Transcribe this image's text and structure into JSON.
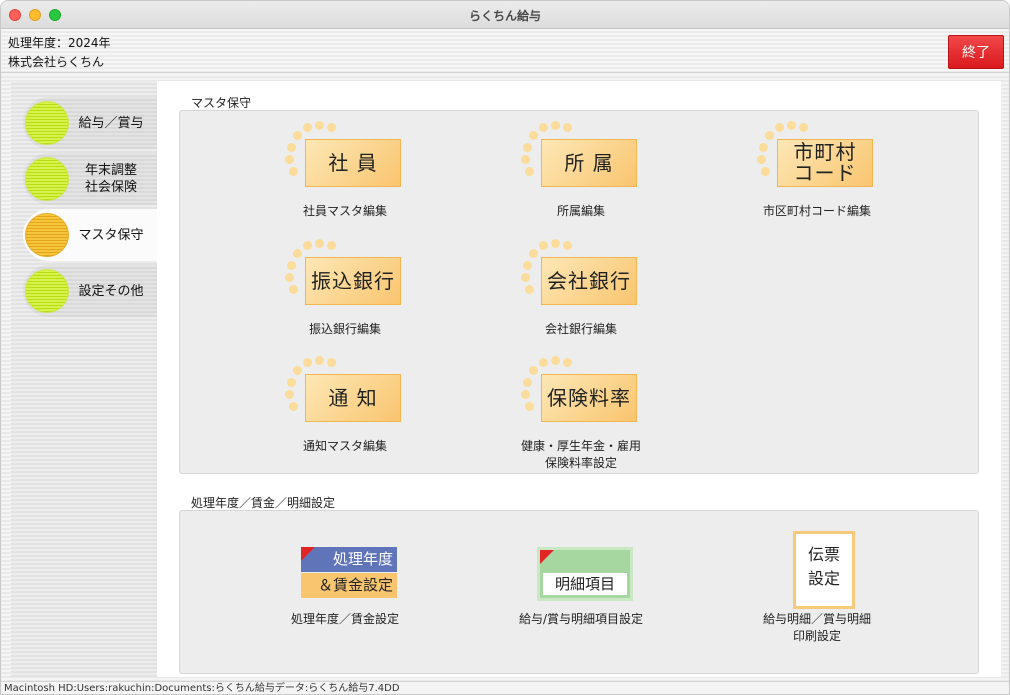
{
  "window": {
    "title": "らくちん給与"
  },
  "header": {
    "year_line": "処理年度：2024年",
    "company": "株式会社らくちん",
    "exit_label": "終了"
  },
  "sidebar": {
    "items": [
      {
        "lines": [
          "給与／賞与"
        ],
        "active": false
      },
      {
        "lines": [
          "年末調整",
          "社会保険"
        ],
        "active": false
      },
      {
        "lines": [
          "マスタ保守"
        ],
        "active": true
      },
      {
        "lines": [
          "設定その他"
        ],
        "active": false
      }
    ]
  },
  "sections": {
    "master": {
      "title": "マスタ保守",
      "tiles": [
        {
          "button": "社 員",
          "caption": [
            "社員マスタ編集"
          ]
        },
        {
          "button": "所 属",
          "caption": [
            "所属編集"
          ]
        },
        {
          "button_lines": [
            "市町村",
            "コード"
          ],
          "caption": [
            "市区町村コード編集"
          ]
        },
        {
          "button": "振込銀行",
          "caption": [
            "振込銀行編集"
          ]
        },
        {
          "button": "会社銀行",
          "caption": [
            "会社銀行編集"
          ]
        },
        {
          "button": "通 知",
          "caption": [
            "通知マスタ編集"
          ]
        },
        {
          "button": "保険料率",
          "caption": [
            "健康・厚生年金・雇用",
            "保険料率設定"
          ]
        }
      ]
    },
    "settings": {
      "title": "処理年度／賃金／明細設定",
      "tiles": [
        {
          "card_top": "処理年度",
          "card_bottom": "＆賃金設定",
          "caption": [
            "処理年度／賃金設定"
          ]
        },
        {
          "card_label": "明細項目",
          "caption": [
            "給与/賞与明細項目設定"
          ]
        },
        {
          "card_lines": [
            "伝票",
            "設定"
          ],
          "caption": [
            "給与明細／賞与明細",
            "印刷設定"
          ]
        }
      ]
    }
  },
  "status_bar": {
    "path": "Macintosh HD:Users:rakuchin:Documents:らくちん給与データ:らくちん給与7.4DD"
  },
  "colors": {
    "exit": "#e0262a",
    "tile_face": "#f9c56f",
    "sidebar_dot": "#c7e82e",
    "sidebar_dot_active": "#efb52b"
  }
}
